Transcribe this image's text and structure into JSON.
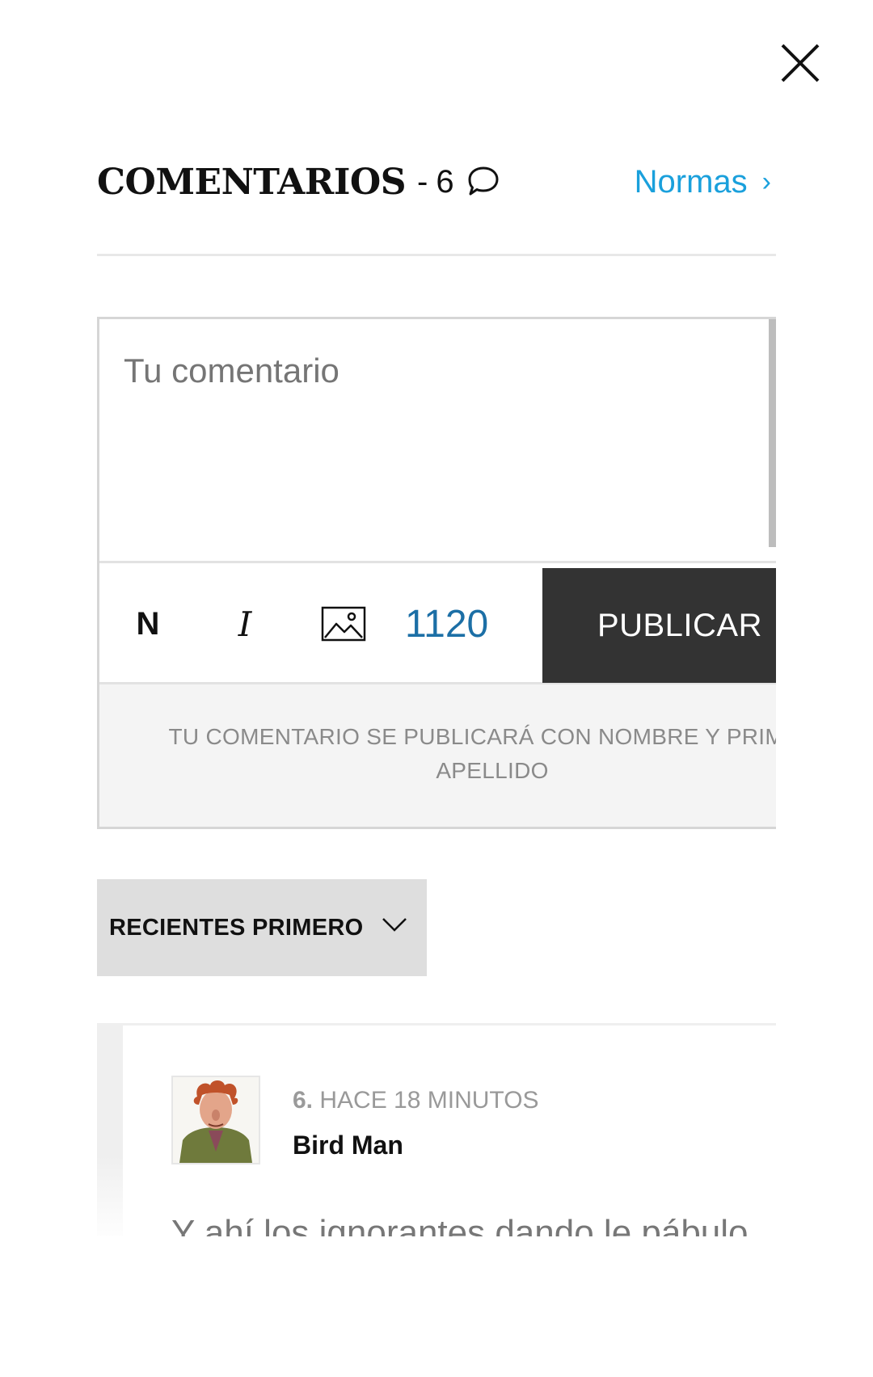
{
  "header": {
    "title": "COMENTARIOS",
    "separator": "-",
    "count": "6",
    "rules_link": "Normas",
    "rules_chevron": "›"
  },
  "composer": {
    "placeholder": "Tu comentario",
    "bold_label": "N",
    "italic_label": "I",
    "char_count": "1120",
    "publish_label": "PUBLICAR",
    "notice": "TU COMENTARIO SE PUBLICARÁ CON NOMBRE Y PRIMER APELLIDO"
  },
  "sort": {
    "selected": "RECIENTES PRIMERO"
  },
  "comments": [
    {
      "number": "6.",
      "time": "HACE 18 MINUTOS",
      "author": "Bird Man",
      "text": "Y ahí los ignorantes dando le pábulo"
    }
  ],
  "icons": {
    "close": "close-icon",
    "comment": "comment-bubble-icon",
    "image": "image-icon",
    "sort_chevron": "chevron-down-icon"
  },
  "colors": {
    "link": "#1aa0dc",
    "char_count": "#1c6fa6",
    "publish_bg": "#333333",
    "sort_bg": "#dedede",
    "notice_bg": "#f4f4f4"
  }
}
